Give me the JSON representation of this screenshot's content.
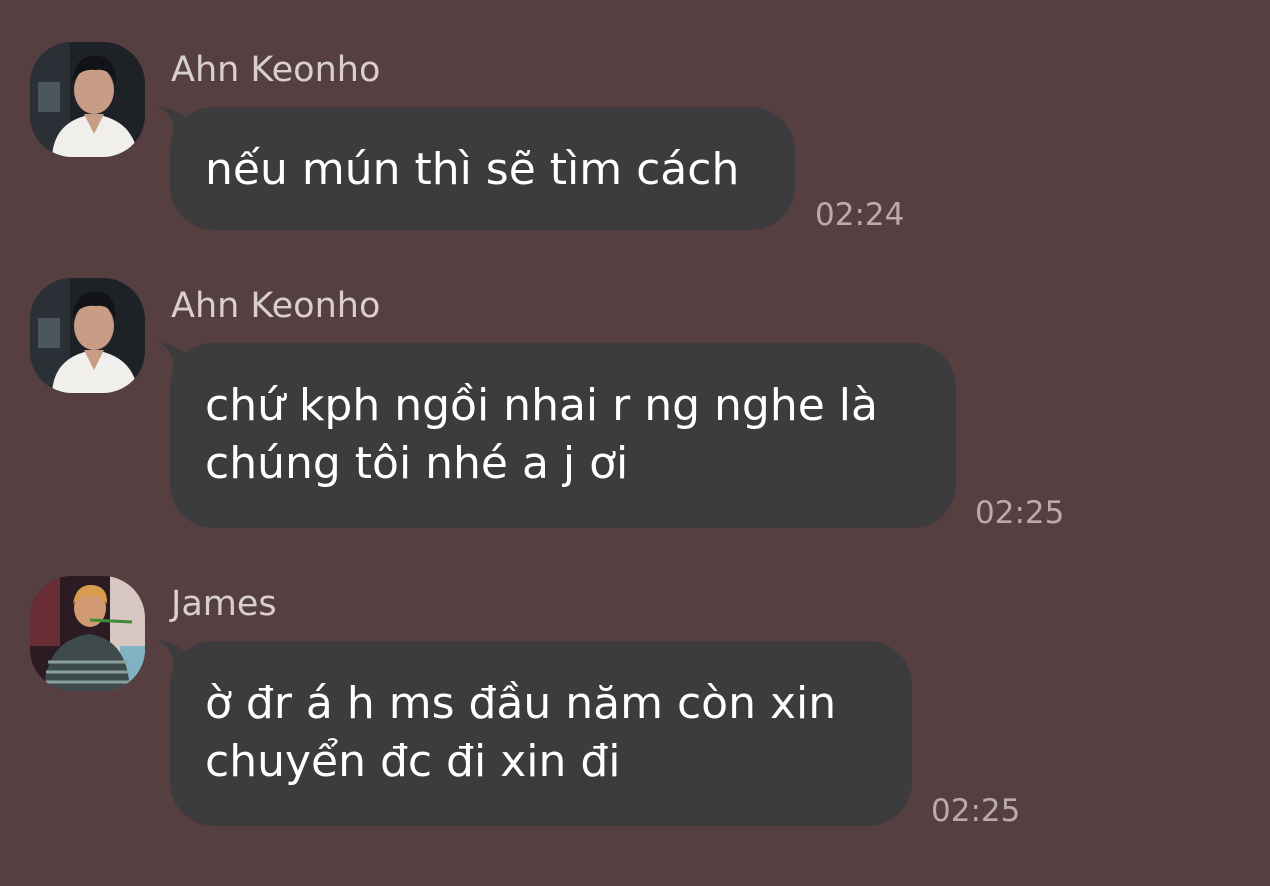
{
  "chat": {
    "messages": [
      {
        "sender": "Ahn Keonho",
        "avatar_icon": "avatar-photo-ahn-keonho",
        "lines": [
          "nếu mún thì sẽ tìm cách"
        ],
        "time": "02:24"
      },
      {
        "sender": "Ahn Keonho",
        "avatar_icon": "avatar-photo-ahn-keonho",
        "lines": [
          "chứ kph ngồi nhai r ng nghe là",
          "chúng tôi nhé a j ơi"
        ],
        "time": "02:25"
      },
      {
        "sender": "James",
        "avatar_icon": "avatar-photo-james",
        "lines": [
          "ờ đr á h ms đầu năm còn xin",
          "chuyển đc đi xin đi"
        ],
        "time": "02:25"
      }
    ]
  },
  "colors": {
    "background": "#553f41",
    "bubble": "#3c3b3d",
    "sender_text": "#d9cfd0",
    "time_text": "#b9abac",
    "message_text": "#ffffff"
  }
}
